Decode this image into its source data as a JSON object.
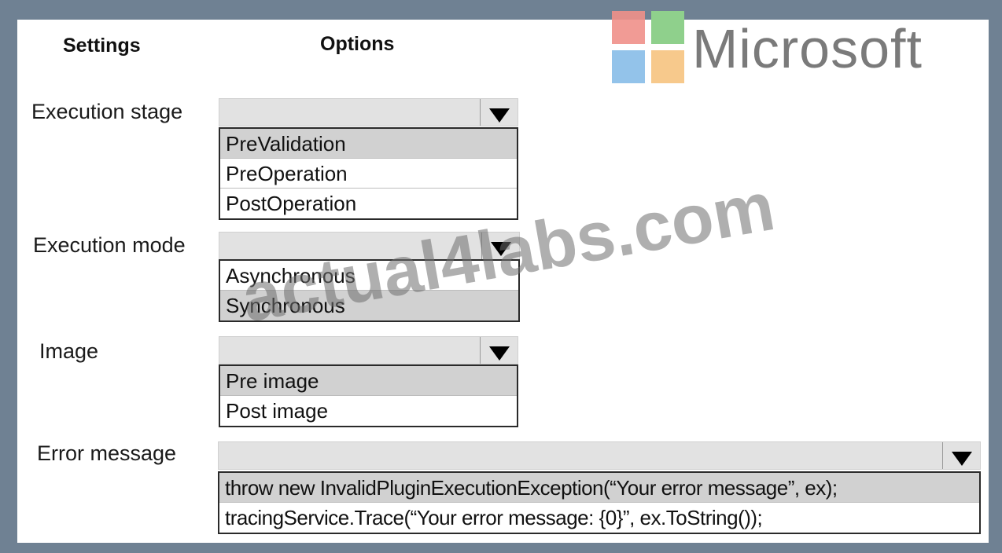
{
  "headers": {
    "settings": "Settings",
    "options": "Options"
  },
  "brand": {
    "name": "Microsoft",
    "colors": [
      "#f25022",
      "#7fba00",
      "#00a4ef",
      "#ffb900"
    ]
  },
  "watermark": "actual4labs.com",
  "rows": {
    "execution_stage": {
      "label": "Execution stage",
      "options": [
        "PreValidation",
        "PreOperation",
        "PostOperation"
      ],
      "highlighted": "PreValidation"
    },
    "execution_mode": {
      "label": "Execution mode",
      "options": [
        "Asynchronous",
        "Synchronous"
      ],
      "highlighted": "Synchronous"
    },
    "image": {
      "label": "Image",
      "options": [
        "Pre image",
        "Post image"
      ],
      "highlighted": "Pre image"
    },
    "error_message": {
      "label": "Error message",
      "options": [
        "throw new InvalidPluginExecutionException(“Your error message”, ex);",
        "tracingService.Trace(“Your error message: {0}”, ex.ToString());"
      ],
      "highlighted": "throw new InvalidPluginExecutionException(“Your error message”, ex);"
    }
  }
}
